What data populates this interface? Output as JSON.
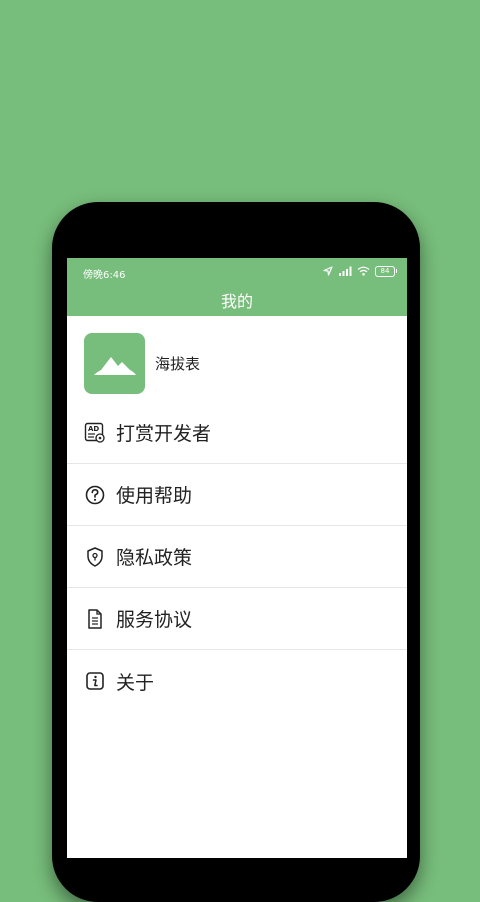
{
  "status": {
    "time": "傍晚6:46",
    "battery": "84"
  },
  "header": {
    "title": "我的"
  },
  "profile": {
    "app_name": "海拔表"
  },
  "menu": [
    {
      "label": "打赏开发者",
      "icon": "ad-icon"
    },
    {
      "label": "使用帮助",
      "icon": "help-icon"
    },
    {
      "label": "隐私政策",
      "icon": "shield-icon"
    },
    {
      "label": "服务协议",
      "icon": "document-icon"
    },
    {
      "label": "关于",
      "icon": "info-icon"
    }
  ],
  "colors": {
    "accent": "#77bd7b",
    "background": "#77bd7b"
  }
}
